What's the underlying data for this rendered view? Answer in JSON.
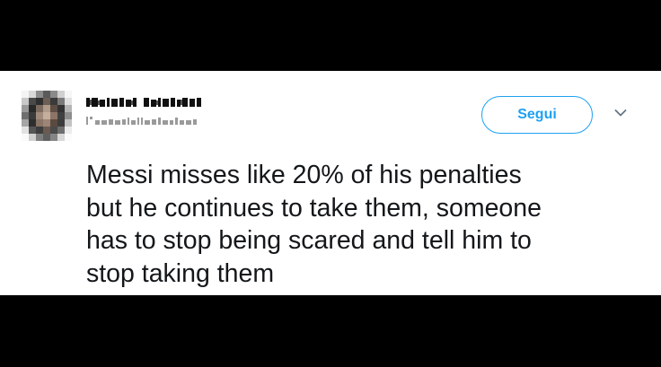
{
  "tweet": {
    "follow_label": "Segui",
    "text": "Messi misses like 20% of his penalties\nbut he continues to take them, someone\nhas to stop being scared and tell him to\nstop taking them"
  },
  "icons": {
    "avatar": "pixelated-profile-picture",
    "menu": "chevron-down-icon"
  },
  "colors": {
    "accent": "#1da1f2",
    "text": "#14171a",
    "background_bars": "#000000",
    "card": "#ffffff"
  }
}
